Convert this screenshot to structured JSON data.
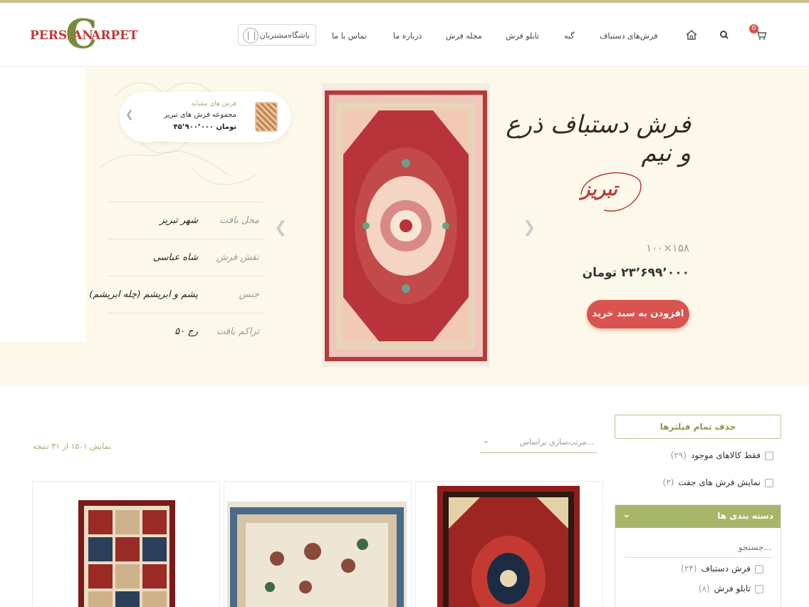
{
  "header": {
    "logo_left": "PERSIAN",
    "logo_c": "C",
    "logo_right": "ARPET",
    "club_label": "باشگاه‌مشتریان",
    "nav": [
      "فرش‌های دستباف",
      "گبه",
      "تابلو فرش",
      "مجله فرش",
      "درباره ما",
      "تماس با ما"
    ],
    "cart_count": "0"
  },
  "hero": {
    "title": "فرش دستباف ذرع و نیم",
    "subtitle": "تبریز",
    "size": "۱۰۰×۱۵۸",
    "price": "۲۳٬۶۹۹٬۰۰۰ تومان",
    "add_to_cart": "افزودن به سبد خرید",
    "similar": {
      "label": "فرش های مشابه",
      "title": "مجموعه فرش های تبریز",
      "price": "۴۵٬۹۰۰٬۰۰۰ تومان"
    },
    "specs": [
      {
        "key": "محل بافت",
        "value": "شهر تبریز"
      },
      {
        "key": "نقش فرش",
        "value": "شاه عباسی"
      },
      {
        "key": "جنس",
        "value": "پشم و ابریشم (چله ابریشم)"
      },
      {
        "key": "تراکم بافت",
        "value": "۵۰ رج"
      }
    ]
  },
  "filters": {
    "clear_all": "حذف تمام فیلترها",
    "in_stock": {
      "label": "فقط کالاهای موجود",
      "count": "(۲۹)"
    },
    "pairs": {
      "label": "نمایش فرش های جفت",
      "count": "(۳)"
    },
    "categories_title": "دسته بندی ها",
    "search_placeholder": "جستجو...",
    "categories": [
      {
        "label": "فرش دستباف",
        "count": "(۲۴)"
      },
      {
        "label": "تابلو فرش",
        "count": "(۸)"
      }
    ]
  },
  "toolbar": {
    "sort_placeholder": "مرتب‌سازی براساس...",
    "result_count": "نمایش ۱–۱۵ از ۳۱ نتیجه"
  },
  "colors": {
    "accent_red": "#d9534f",
    "accent_olive": "#a8b66a",
    "hero_bg": "#fcf9ea"
  }
}
